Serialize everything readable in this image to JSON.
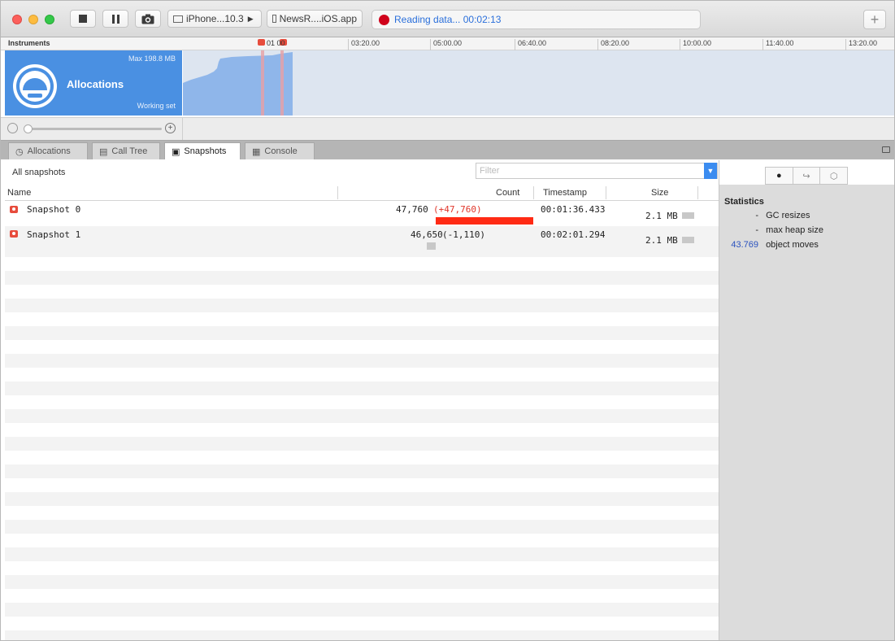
{
  "toolbar": {
    "device_label": "iPhone...10.3",
    "app_label": "NewsR....iOS.app",
    "status_text": "Reading data... 00:02:13",
    "add_label": "+"
  },
  "timeline": {
    "instruments_label": "Instruments",
    "markers_label": "01 00",
    "ticks": [
      "03:20.00",
      "05:00.00",
      "06:40.00",
      "08:20.00",
      "10:00.00",
      "11:40.00",
      "13:20.00"
    ]
  },
  "track": {
    "name": "Allocations",
    "max_label": "Max 198.8 MB",
    "working_label": "Working set"
  },
  "tabs": [
    {
      "label": "Allocations",
      "icon": "clock-icon"
    },
    {
      "label": "Call Tree",
      "icon": "call-tree-icon"
    },
    {
      "label": "Snapshots",
      "icon": "camera-icon"
    },
    {
      "label": "Console",
      "icon": "console-icon"
    }
  ],
  "filter": {
    "scope_label": "All snapshots",
    "placeholder": "Filter"
  },
  "table": {
    "columns": [
      "Name",
      "Count",
      "Timestamp",
      "Size"
    ],
    "rows": [
      {
        "name": "Snapshot 0",
        "count": "47,760",
        "delta": "(+47,760)",
        "timestamp": "00:01:36.433",
        "size": "2.1 MB"
      },
      {
        "name": "Snapshot 1",
        "count": "46,650",
        "delta": "(-1,110)",
        "timestamp": "00:02:01.294",
        "size": "2.1 MB"
      }
    ]
  },
  "inspector": {
    "title": "Statistics",
    "stats": [
      {
        "value": "-",
        "label": "GC resizes"
      },
      {
        "value": "-",
        "label": "max heap size"
      },
      {
        "value": "43.769",
        "label": "object moves"
      }
    ]
  },
  "colors": {
    "accent": "#4a90e2",
    "recording": "#d0021b",
    "snapshot_bar": "#ff3b1f"
  }
}
